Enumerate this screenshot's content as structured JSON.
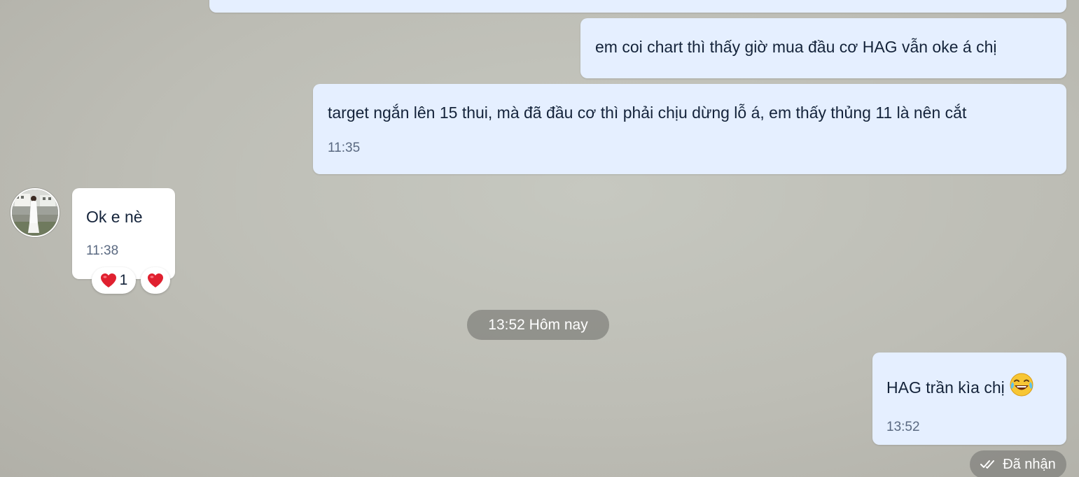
{
  "messages": [
    {
      "text": "em coi chart thì thấy giờ mua đầu cơ HAG vẫn oke á chị"
    },
    {
      "text": "target ngắn lên 15 thui, mà đã đầu cơ thì phải chịu dừng lỗ á, em thấy thủng 11 là nên cắt",
      "time": "11:35"
    },
    {
      "text": "Ok e nè",
      "time": "11:38",
      "reaction_count": "1"
    },
    {
      "text": "HAG trần kìa chị",
      "time": "13:52",
      "emoji": "laugh-cry-emoji"
    }
  ],
  "divider": {
    "label": "13:52 Hôm nay"
  },
  "status": {
    "label": "Đã nhận",
    "icon": "double-check-icon"
  },
  "colors": {
    "outgoing_bubble": "#e5efff",
    "incoming_bubble": "#ffffff",
    "reaction_heart": "#e0202f"
  }
}
